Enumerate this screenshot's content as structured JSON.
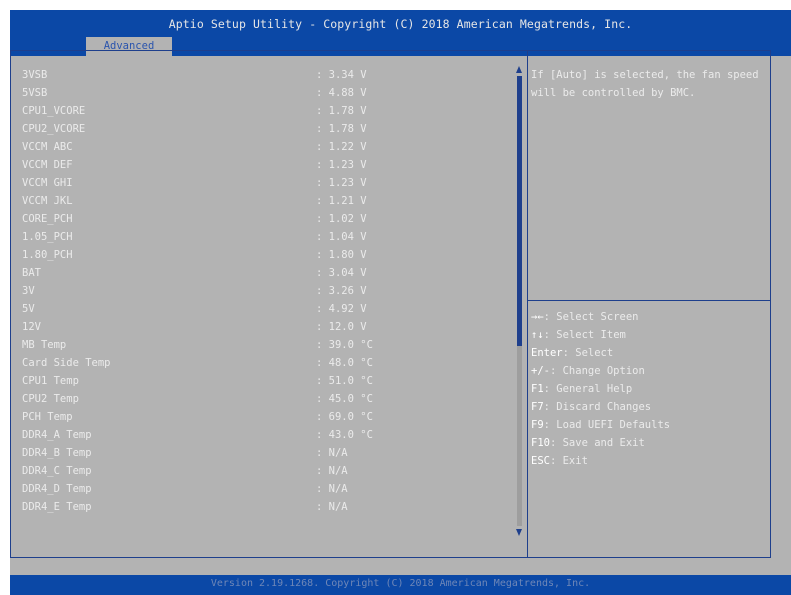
{
  "header": {
    "title": "Aptio Setup Utility - Copyright (C) 2018 American Megatrends, Inc.",
    "active_tab": "Advanced"
  },
  "readings": [
    {
      "label": "3VSB",
      "value": ": 3.34 V"
    },
    {
      "label": "5VSB",
      "value": ": 4.88 V"
    },
    {
      "label": "CPU1_VCORE",
      "value": ": 1.78 V"
    },
    {
      "label": "CPU2_VCORE",
      "value": ": 1.78 V"
    },
    {
      "label": "VCCM ABC",
      "value": ": 1.22 V"
    },
    {
      "label": "VCCM DEF",
      "value": ": 1.23 V"
    },
    {
      "label": "VCCM GHI",
      "value": ": 1.23 V"
    },
    {
      "label": "VCCM JKL",
      "value": ": 1.21 V"
    },
    {
      "label": "CORE_PCH",
      "value": ": 1.02 V"
    },
    {
      "label": "1.05_PCH",
      "value": ": 1.04 V"
    },
    {
      "label": "1.80_PCH",
      "value": ": 1.80 V"
    },
    {
      "label": "BAT",
      "value": ": 3.04 V"
    },
    {
      "label": "3V",
      "value": ": 3.26 V"
    },
    {
      "label": "5V",
      "value": ": 4.92 V"
    },
    {
      "label": "12V",
      "value": ": 12.0 V"
    },
    {
      "label": "MB Temp",
      "value": ": 39.0 °C"
    },
    {
      "label": "Card Side Temp",
      "value": ": 48.0 °C"
    },
    {
      "label": "CPU1 Temp",
      "value": ": 51.0 °C"
    },
    {
      "label": "CPU2 Temp",
      "value": ": 45.0 °C"
    },
    {
      "label": "PCH Temp",
      "value": ": 69.0 °C"
    },
    {
      "label": "DDR4_A Temp",
      "value": ": 43.0 °C"
    },
    {
      "label": "DDR4_B Temp",
      "value": ": N/A"
    },
    {
      "label": "DDR4_C Temp",
      "value": ": N/A"
    },
    {
      "label": "DDR4_D Temp",
      "value": ": N/A"
    },
    {
      "label": "DDR4_E Temp",
      "value": ": N/A"
    }
  ],
  "scroll": {
    "position_fraction": 0.6
  },
  "help": {
    "text": "If [Auto] is selected, the fan speed will be controlled by BMC."
  },
  "keys": [
    {
      "key": "→←",
      "desc": ": Select Screen"
    },
    {
      "key": "↑↓",
      "desc": ": Select Item"
    },
    {
      "key": "Enter",
      "desc": ": Select"
    },
    {
      "key": "+/-",
      "desc": ": Change Option"
    },
    {
      "key": "F1",
      "desc": ": General Help"
    },
    {
      "key": "F7",
      "desc": ": Discard Changes"
    },
    {
      "key": "F9",
      "desc": ": Load UEFI Defaults"
    },
    {
      "key": "F10",
      "desc": ": Save and Exit"
    },
    {
      "key": "ESC",
      "desc": ": Exit"
    }
  ],
  "footer": {
    "text": "Version 2.19.1268. Copyright (C) 2018 American Megatrends, Inc."
  },
  "colors": {
    "header_blue": "#0b48a6",
    "panel_gray": "#b3b3b3",
    "text": "#ebebeb",
    "border_blue": "#1e3f8c"
  }
}
